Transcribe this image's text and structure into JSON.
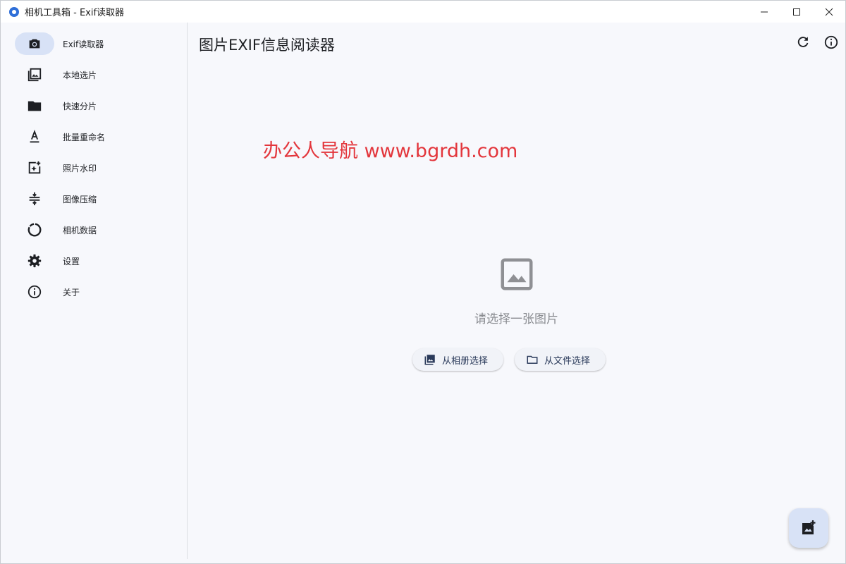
{
  "window": {
    "title": "相机工具箱 - Exif读取器",
    "minimize": "—",
    "maximize": "☐",
    "close": "✕"
  },
  "sidebar": {
    "items": [
      {
        "label": "Exif读取器",
        "icon": "camera-icon",
        "active": true
      },
      {
        "label": "本地选片",
        "icon": "photo-library-icon"
      },
      {
        "label": "快速分片",
        "icon": "folder-icon"
      },
      {
        "label": "批量重命名",
        "icon": "text-format-icon"
      },
      {
        "label": "照片水印",
        "icon": "add-photo-sparkle-icon"
      },
      {
        "label": "图像压缩",
        "icon": "compress-icon"
      },
      {
        "label": "相机数据",
        "icon": "donut-icon"
      },
      {
        "label": "设置",
        "icon": "gear-icon"
      },
      {
        "label": "关于",
        "icon": "info-icon"
      }
    ]
  },
  "main": {
    "title": "图片EXIF信息阅读器",
    "watermark": "办公人导航  www.bgrdh.com",
    "empty_hint": "请选择一张图片",
    "btn_album": "从相册选择",
    "btn_file": "从文件选择"
  },
  "colors": {
    "accent": "#d8e2f6",
    "watermark": "#e3363c",
    "background": "#f7f8fc"
  }
}
